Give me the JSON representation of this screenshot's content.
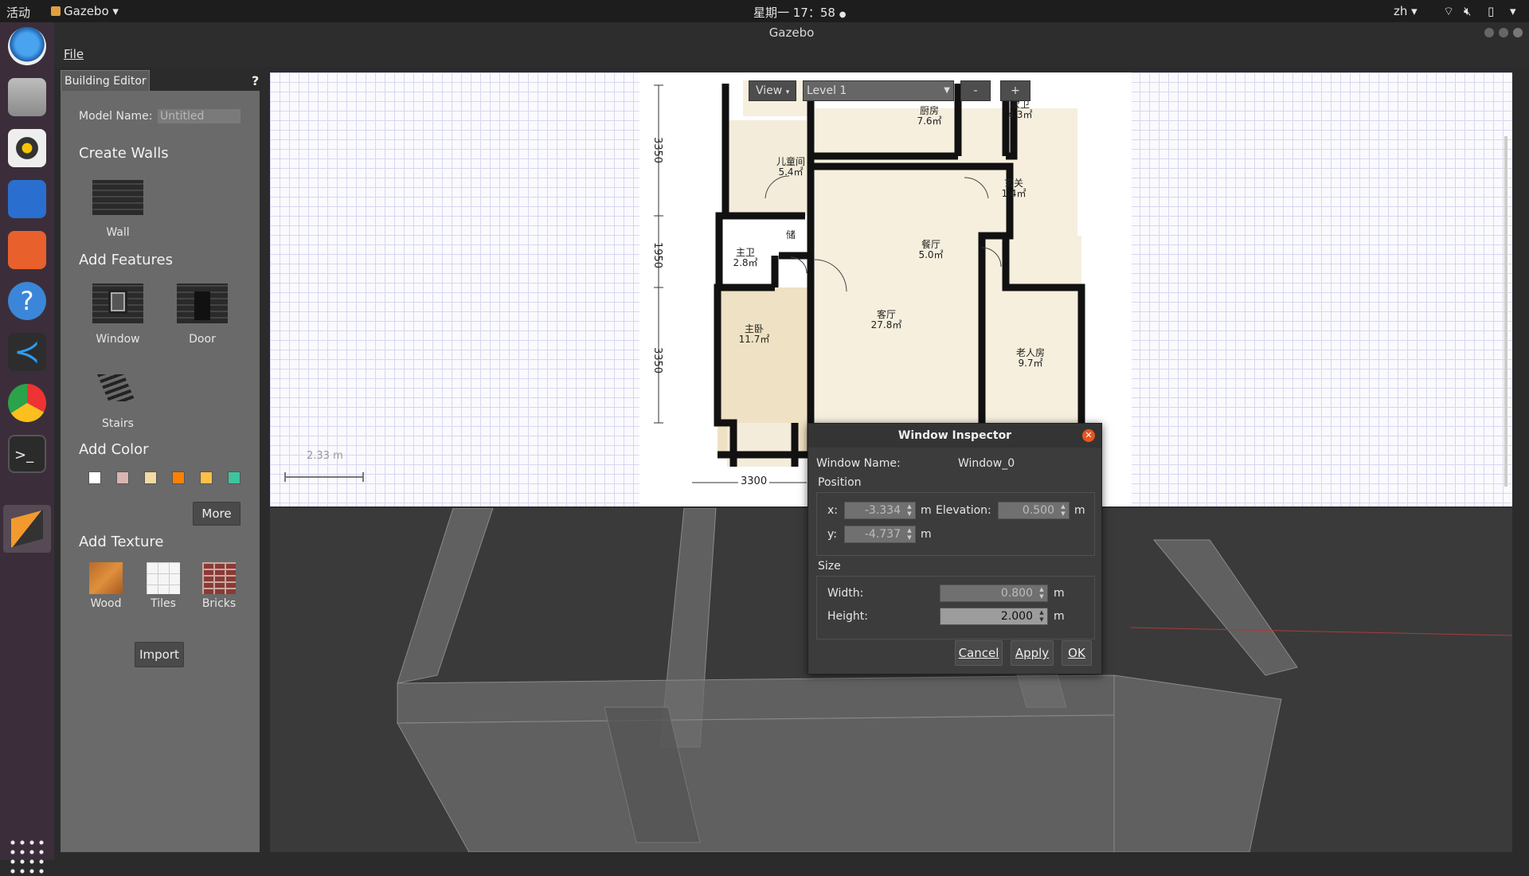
{
  "topbar": {
    "activities": "活动",
    "app_menu": "Gazebo",
    "clock": "星期一 17：58",
    "lang": "zh"
  },
  "window": {
    "title": "Gazebo",
    "menu_file": "File"
  },
  "left_panel": {
    "tab": "Building Editor",
    "help": "?",
    "model_name_label": "Model Name:",
    "model_name_value": "Untitled",
    "create_walls": "Create Walls",
    "wall": "Wall",
    "add_features": "Add Features",
    "window": "Window",
    "door": "Door",
    "stairs": "Stairs",
    "add_color": "Add Color",
    "colors": [
      "#ffffff",
      "#d8b5b0",
      "#f2dba4",
      "#ff8000",
      "#ffc04a",
      "#3fc4a0"
    ],
    "more": "More",
    "add_texture": "Add Texture",
    "wood": "Wood",
    "tiles": "Tiles",
    "bricks": "Bricks",
    "import": "Import"
  },
  "editor_toolbar": {
    "view": "View",
    "level": "Level 1",
    "minus": "-",
    "plus": "+"
  },
  "scale_label": "2.33 m",
  "floorplan": {
    "rooms": [
      {
        "name": "厨房",
        "area": "7.6㎡"
      },
      {
        "name": "次卫",
        "area": "4.3㎡"
      },
      {
        "name": "儿童间",
        "area": "5.4㎡"
      },
      {
        "name": "玄关",
        "area": "1.4㎡"
      },
      {
        "name": "储",
        "area": ""
      },
      {
        "name": "主卫",
        "area": "2.8㎡"
      },
      {
        "name": "餐厅",
        "area": "5.0㎡"
      },
      {
        "name": "客厅",
        "area": "27.8㎡"
      },
      {
        "name": "主卧",
        "area": "11.7㎡"
      },
      {
        "name": "老人房",
        "area": "9.7㎡"
      }
    ],
    "dims": [
      "3350",
      "1950",
      "3350",
      "3300"
    ]
  },
  "dialog": {
    "title": "Window Inspector",
    "name_label": "Window Name:",
    "name_value": "Window_0",
    "position": "Position",
    "x_label": "x:",
    "x_value": "-3.334",
    "y_label": "y:",
    "y_value": "-4.737",
    "elevation_label": "Elevation:",
    "elevation_value": "0.500",
    "unit": "m",
    "size": "Size",
    "width_label": "Width:",
    "width_value": "0.800",
    "height_label": "Height:",
    "height_value": "2.000",
    "cancel": "Cancel",
    "apply": "Apply",
    "ok": "OK"
  }
}
